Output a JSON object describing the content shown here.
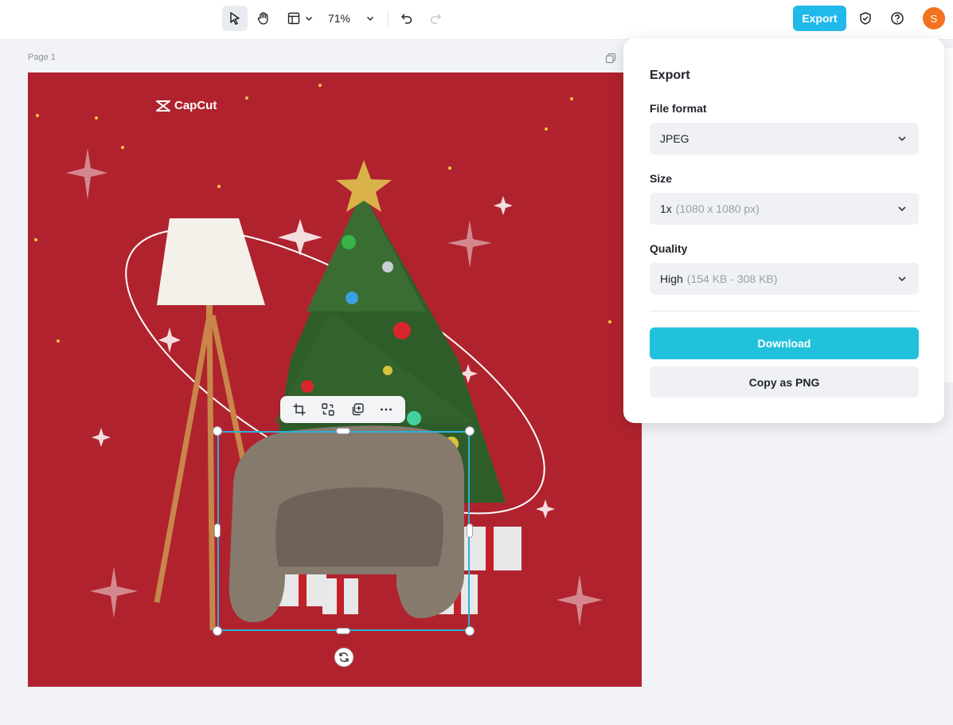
{
  "toolbar": {
    "zoom": "71%",
    "export_label": "Export",
    "avatar_initial": "S"
  },
  "canvas": {
    "page_label": "Page 1",
    "brand_text": "CapCut",
    "background_color": "#b0232e"
  },
  "colors": {
    "accent": "#21b8ea",
    "download": "#21c1db",
    "avatar": "#f37220",
    "selection": "#2db0d8"
  },
  "export_panel": {
    "title": "Export",
    "file_format": {
      "label": "File format",
      "value": "JPEG"
    },
    "size": {
      "label": "Size",
      "value": "1x",
      "detail": "(1080 x 1080 px)"
    },
    "quality": {
      "label": "Quality",
      "value": "High",
      "detail": "(154 KB - 308 KB)"
    },
    "download_label": "Download",
    "copy_label": "Copy as PNG"
  },
  "icons": {
    "select": "cursor-arrow-icon",
    "hand": "hand-icon",
    "layout": "layout-icon",
    "undo": "undo-icon",
    "redo": "redo-icon",
    "shield": "shield-check-icon",
    "help": "help-icon",
    "crop": "crop-icon",
    "replace": "replace-icon",
    "duplicate": "duplicate-icon",
    "more": "more-icon",
    "rotate": "rotate-icon"
  }
}
